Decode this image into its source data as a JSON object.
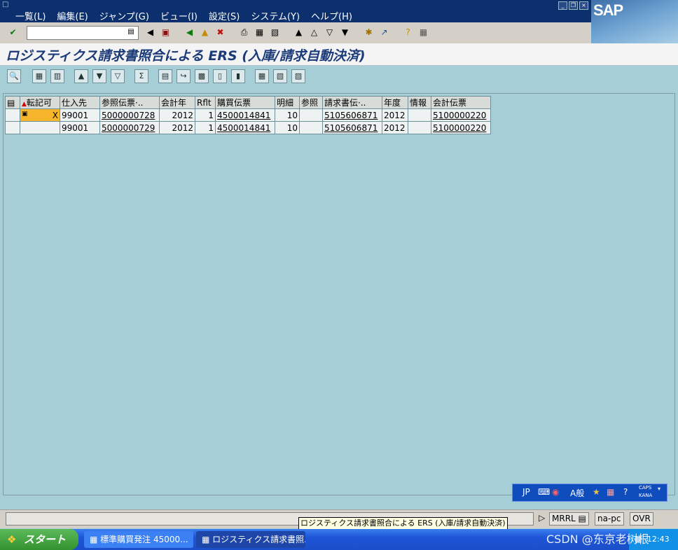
{
  "menu": {
    "items": [
      "一覧(L)",
      "編集(E)",
      "ジャンプ(G)",
      "ビュー(I)",
      "設定(S)",
      "システム(Y)",
      "ヘルプ(H)"
    ]
  },
  "logo": "SAP",
  "command_field": {
    "value": ""
  },
  "title": "ロジスティクス請求書照合による ERS (入庫/請求自動決済)",
  "grid": {
    "headers": [
      "転記可",
      "仕入先",
      "参照伝票·..",
      "会計年",
      "Rflt",
      "購買伝票",
      "明細",
      "参照",
      "請求書伝·..",
      "年度",
      "情報",
      "会計伝票"
    ],
    "rows": [
      [
        "X",
        "99001",
        "5000000728",
        "2012",
        "1",
        "4500014841",
        "10",
        "",
        "5105606871",
        "2012",
        "",
        "5100000220"
      ],
      [
        "",
        "99001",
        "5000000729",
        "2012",
        "1",
        "4500014841",
        "10",
        "",
        "5105606871",
        "2012",
        "",
        "5100000220"
      ]
    ]
  },
  "ime": {
    "lang": "JP",
    "mode": "A般",
    "caps": "CAPS",
    "kana": "KANA"
  },
  "status": {
    "tooltip": "ロジスティクス請求書照合による ERS (入庫/請求自動決済)",
    "system": "MRRL",
    "host": "na-pc",
    "mode": "OVR"
  },
  "taskbar": {
    "start": "スタート",
    "tasks": [
      "標準購買発注 45000...",
      "ロジスティクス請求書照..."
    ],
    "clock": "12:43"
  },
  "watermark": "CSDN @东京老树根"
}
